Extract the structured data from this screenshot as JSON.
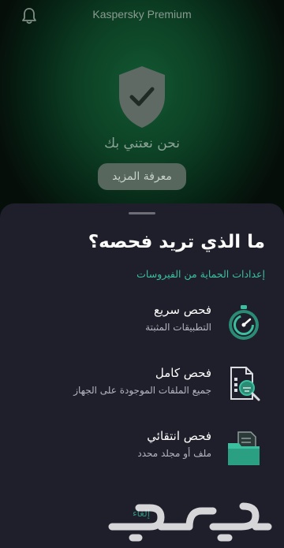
{
  "app": {
    "title": "Kaspersky Premium",
    "status_text": "نحن نعتني بك",
    "learn_more_label": "معرفة المزيد"
  },
  "sheet": {
    "title": "ما الذي تريد فحصه؟",
    "settings_link": "إعدادات الحماية من الفيروسات",
    "items": [
      {
        "name": "فحص سريع",
        "description": "التطبيقات المثبتة",
        "icon": "stopwatch-icon"
      },
      {
        "name": "فحص كامل",
        "description": "جميع الملفات الموجودة على الجهاز",
        "icon": "file-magnifier-icon"
      },
      {
        "name": "فحص انتقائي",
        "description": "ملف أو مجلد محدد",
        "icon": "folder-icon"
      }
    ],
    "bottom_label": "إلغاء"
  },
  "colors": {
    "accent": "#3bbf9e",
    "sheet_bg": "#1f1f2b",
    "green_bg": "#14653a"
  }
}
